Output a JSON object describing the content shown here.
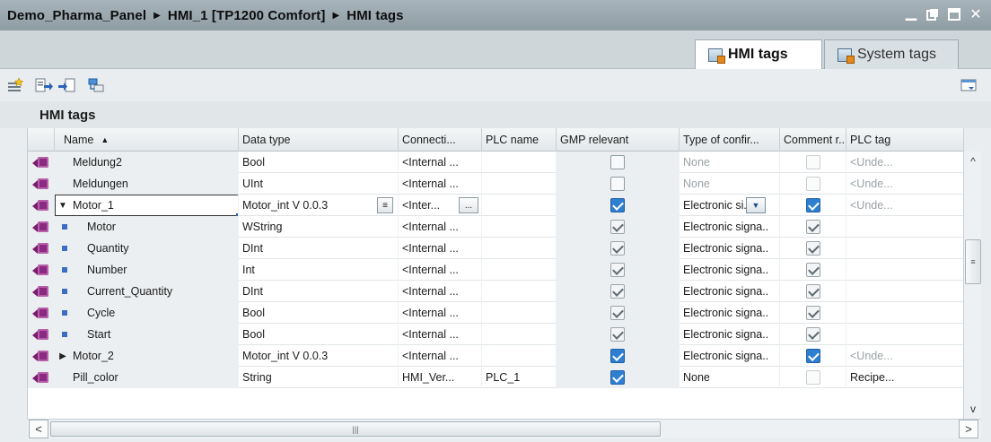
{
  "title_bar": {
    "crumbs": [
      "Demo_Pharma_Panel",
      "HMI_1 [TP1200 Comfort]",
      "HMI tags"
    ],
    "window_controls": [
      "minimize",
      "float",
      "maximize",
      "close"
    ]
  },
  "tabs": [
    {
      "label": "HMI tags",
      "active": true
    },
    {
      "label": "System tags",
      "active": false
    }
  ],
  "toolbar": {
    "buttons": [
      "add-tag-icon",
      "export-icon",
      "import-icon",
      "tag-properties-icon"
    ],
    "right_button": "show-hide-columns-icon"
  },
  "section": {
    "title": "HMI tags"
  },
  "columns": {
    "name": "Name",
    "data_type": "Data type",
    "connection": "Connecti...",
    "plc_name": "PLC name",
    "gmp_relevant": "GMP relevant",
    "type_of_confirmation": "Type of confir...",
    "comment_required": "Comment r..",
    "plc_tag": "PLC tag"
  },
  "rows": [
    {
      "name": "Meldung2",
      "level": 0,
      "expander": "",
      "data_type": "Bool",
      "connection": "<Internal ...",
      "plc_name": "",
      "gmp": "unchecked",
      "confirm": "None",
      "confirm_muted": true,
      "comment": "disabled",
      "plc_tag": "<Unde..."
    },
    {
      "name": "Meldungen",
      "level": 0,
      "expander": "",
      "data_type": "UInt",
      "connection": "<Internal ...",
      "plc_name": "",
      "gmp": "unchecked",
      "confirm": "None",
      "confirm_muted": true,
      "comment": "disabled",
      "plc_tag": "<Unde..."
    },
    {
      "name": "Motor_1",
      "level": 0,
      "expander": "▼",
      "data_type": "Motor_int V 0.0.3",
      "connection": "<Inter...",
      "plc_name": "",
      "gmp": "checked-blue",
      "confirm": "Electronic si...",
      "confirm_muted": false,
      "comment": "checked-blue",
      "plc_tag": "<Unde...",
      "selected": true
    },
    {
      "name": "Motor",
      "level": 1,
      "expander": "",
      "data_type": "WString",
      "connection": "<Internal ...",
      "plc_name": "",
      "gmp": "checked-gray",
      "confirm": "Electronic signa..",
      "confirm_muted": false,
      "comment": "checked-gray",
      "plc_tag": ""
    },
    {
      "name": "Quantity",
      "level": 1,
      "expander": "",
      "data_type": "DInt",
      "connection": "<Internal ...",
      "plc_name": "",
      "gmp": "checked-gray",
      "confirm": "Electronic signa..",
      "confirm_muted": false,
      "comment": "checked-gray",
      "plc_tag": ""
    },
    {
      "name": "Number",
      "level": 1,
      "expander": "",
      "data_type": "Int",
      "connection": "<Internal ...",
      "plc_name": "",
      "gmp": "checked-gray",
      "confirm": "Electronic signa..",
      "confirm_muted": false,
      "comment": "checked-gray",
      "plc_tag": ""
    },
    {
      "name": "Current_Quantity",
      "level": 1,
      "expander": "",
      "data_type": "DInt",
      "connection": "<Internal ...",
      "plc_name": "",
      "gmp": "checked-gray",
      "confirm": "Electronic signa..",
      "confirm_muted": false,
      "comment": "checked-gray",
      "plc_tag": ""
    },
    {
      "name": "Cycle",
      "level": 1,
      "expander": "",
      "data_type": "Bool",
      "connection": "<Internal ...",
      "plc_name": "",
      "gmp": "checked-gray",
      "confirm": "Electronic signa..",
      "confirm_muted": false,
      "comment": "checked-gray",
      "plc_tag": ""
    },
    {
      "name": "Start",
      "level": 1,
      "expander": "",
      "data_type": "Bool",
      "connection": "<Internal ...",
      "plc_name": "",
      "gmp": "checked-gray",
      "confirm": "Electronic signa..",
      "confirm_muted": false,
      "comment": "checked-gray",
      "plc_tag": ""
    },
    {
      "name": "Motor_2",
      "level": 0,
      "expander": "▶",
      "data_type": "Motor_int V 0.0.3",
      "connection": "<Internal ...",
      "plc_name": "",
      "gmp": "checked-blue",
      "confirm": "Electronic signa..",
      "confirm_muted": false,
      "comment": "checked-blue",
      "plc_tag": "<Unde..."
    },
    {
      "name": "Pill_color",
      "level": 0,
      "expander": "",
      "data_type": "String",
      "connection": "HMI_Ver...",
      "plc_name": "PLC_1",
      "gmp": "checked-blue",
      "confirm": "None",
      "confirm_muted": false,
      "comment": "disabled",
      "plc_tag": "Recipe..."
    }
  ],
  "scrollbars": {
    "vertical_grip": "≡",
    "horizontal_grip": "|||"
  },
  "colors": {
    "accent_blue": "#2f7fd1",
    "tag_icon": "#8a2a80",
    "title_bar": "#98a6ae"
  }
}
